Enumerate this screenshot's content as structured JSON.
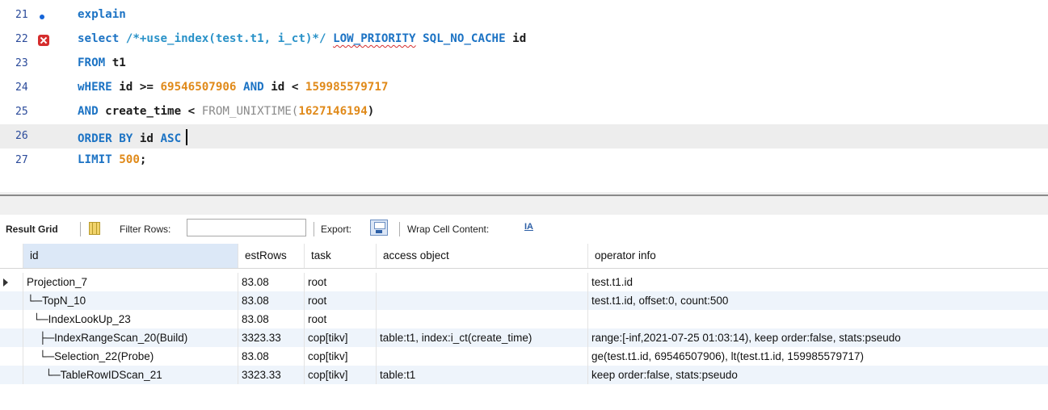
{
  "editor": {
    "lines": [
      {
        "num": "21",
        "parts": [
          [
            "kw",
            "explain"
          ]
        ]
      },
      {
        "num": "22",
        "parts": [
          [
            "kw",
            "select"
          ],
          [
            "txt",
            " "
          ],
          [
            "cmt",
            "/*+use_index(test.t1, i_ct)*/"
          ],
          [
            "txt",
            " "
          ],
          [
            "kwsq",
            "LOW_PRIORITY"
          ],
          [
            "txt",
            " "
          ],
          [
            "kw",
            "SQL_NO_CACHE"
          ],
          [
            "txt",
            " id"
          ]
        ]
      },
      {
        "num": "23",
        "parts": [
          [
            "kw",
            "FROM"
          ],
          [
            "txt",
            " t1"
          ]
        ]
      },
      {
        "num": "24",
        "parts": [
          [
            "kw",
            "wHERE"
          ],
          [
            "txt",
            " id >= "
          ],
          [
            "num",
            "69546507906"
          ],
          [
            "txt",
            " "
          ],
          [
            "kw",
            "AND"
          ],
          [
            "txt",
            " id < "
          ],
          [
            "num",
            "159985579717"
          ]
        ]
      },
      {
        "num": "25",
        "parts": [
          [
            "kw",
            "AND"
          ],
          [
            "txt",
            " create_time < "
          ],
          [
            "fn",
            "FROM_UNIXTIME("
          ],
          [
            "num",
            "1627146194"
          ],
          [
            "txt",
            ")"
          ]
        ]
      },
      {
        "num": "26",
        "parts": [
          [
            "kw",
            "ORDER BY"
          ],
          [
            "txt",
            " id "
          ],
          [
            "kw",
            "ASC"
          ]
        ]
      },
      {
        "num": "27",
        "parts": [
          [
            "kw",
            "LIMIT"
          ],
          [
            "txt",
            " "
          ],
          [
            "num",
            "500"
          ],
          [
            "txt",
            ";"
          ]
        ]
      }
    ]
  },
  "toolbar": {
    "result_grid": "Result Grid",
    "filter_rows": "Filter Rows:",
    "export": "Export:",
    "wrap": "Wrap Cell Content:",
    "wrap_icon": "IA"
  },
  "grid": {
    "columns": [
      "id",
      "estRows",
      "task",
      "access object",
      "operator info"
    ],
    "rows": [
      [
        "Projection_7",
        "83.08",
        "root",
        "",
        "test.t1.id"
      ],
      [
        "└─TopN_10",
        "83.08",
        "root",
        "",
        "test.t1.id, offset:0, count:500"
      ],
      [
        "  └─IndexLookUp_23",
        "83.08",
        "root",
        "",
        ""
      ],
      [
        "    ├─IndexRangeScan_20(Build)",
        "3323.33",
        "cop[tikv]",
        "table:t1, index:i_ct(create_time)",
        "range:[-inf,2021-07-25 01:03:14), keep order:false, stats:pseudo"
      ],
      [
        "    └─Selection_22(Probe)",
        "83.08",
        "cop[tikv]",
        "",
        "ge(test.t1.id, 69546507906), lt(test.t1.id, 159985579717)"
      ],
      [
        "      └─TableRowIDScan_21",
        "3323.33",
        "cop[tikv]",
        "table:t1",
        "keep order:false, stats:pseudo"
      ]
    ]
  }
}
